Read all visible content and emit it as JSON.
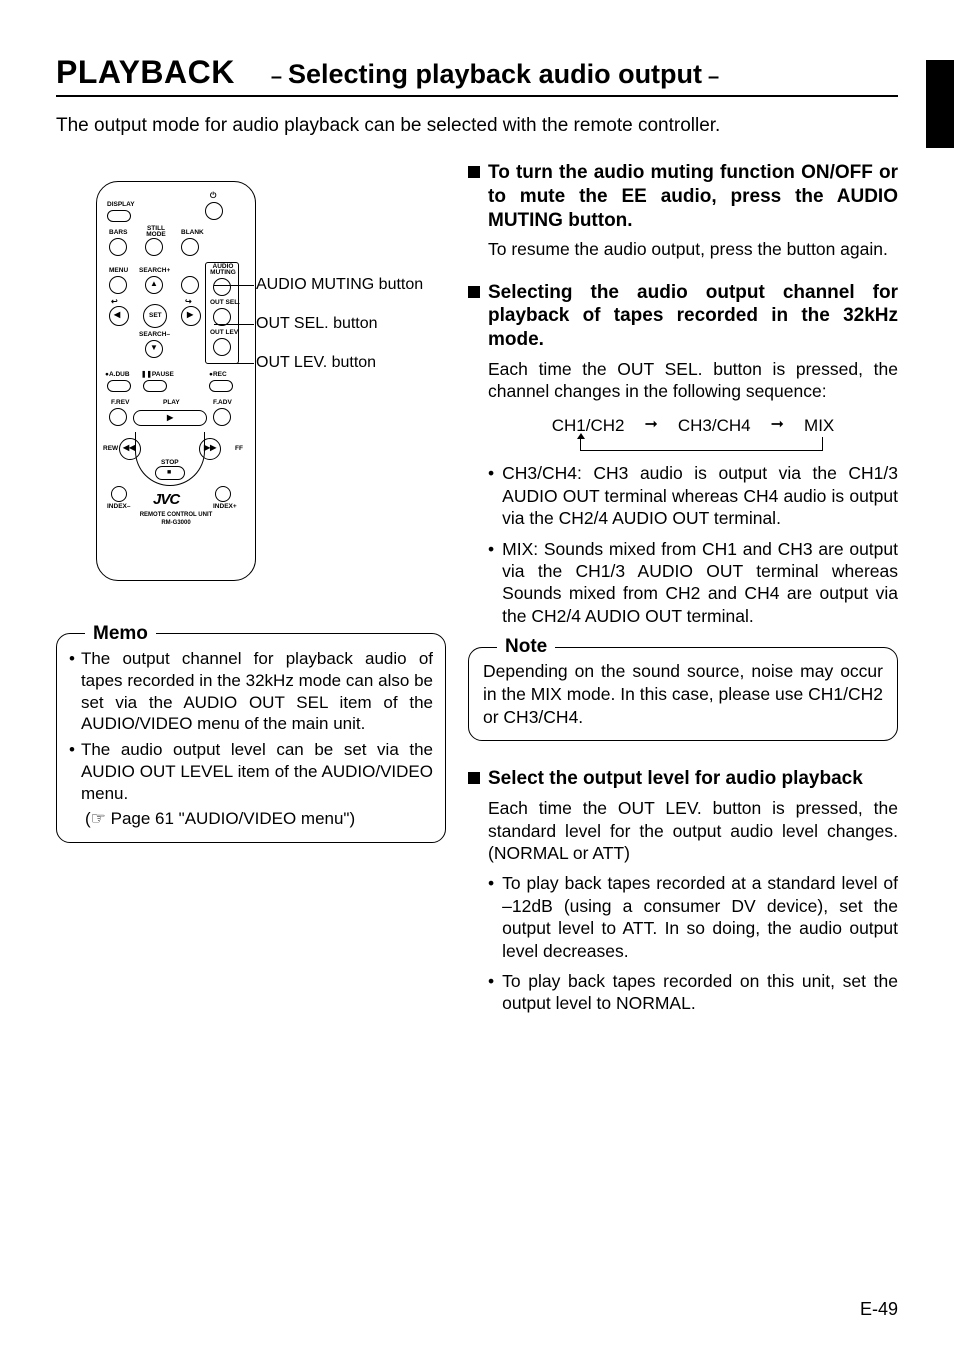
{
  "header": {
    "section": "PLAYBACK",
    "subtitle": "Selecting playback audio output"
  },
  "intro": "The output mode for audio playback can be selected with the remote controller.",
  "remote": {
    "labels": {
      "display": "DISPLAY",
      "bars": "BARS",
      "still_mode": "STILL MODE",
      "blank": "BLANK",
      "menu": "MENU",
      "search_plus": "SEARCH+",
      "audio_muting": "AUDIO MUTING",
      "set": "SET",
      "out_sel": "OUT SEL.",
      "search_minus": "SEARCH–",
      "out_lev": "OUT LEV.",
      "adub": "A.DUB",
      "pause": "PAUSE",
      "rec": "REC",
      "frev": "F.REV",
      "play": "PLAY",
      "fadv": "F.ADV",
      "rew": "REW",
      "ff": "FF",
      "stop": "STOP",
      "index_minus": "INDEX–",
      "index_plus": "INDEX+",
      "brand": "JVC",
      "model_line1": "REMOTE CONTROL UNIT",
      "model_line2": "RM-G3000"
    },
    "callouts": [
      "AUDIO MUTING button",
      "OUT SEL. button",
      "OUT LEV. button"
    ]
  },
  "memo": {
    "title": "Memo",
    "items": [
      "The output channel for playback audio of tapes recorded in the 32kHz mode can also be set via the AUDIO OUT SEL item of the AUDIO/VIDEO menu of the main unit.",
      "The audio output level can be set via the AUDIO OUT LEVEL item of the AUDIO/VIDEO menu."
    ],
    "reference": "(☞ Page 61 \"AUDIO/VIDEO menu\")"
  },
  "right": {
    "muting": {
      "title": "To turn the audio muting function ON/OFF or to mute the EE audio, press the AUDIO MUTING button.",
      "body": "To resume the audio output, press the button again."
    },
    "outsel": {
      "title": "Selecting the audio output channel for playback of tapes recorded in the 32kHz mode.",
      "body": "Each time the OUT SEL. button is pressed, the channel changes in the following sequence:",
      "sequence": [
        "CH1/CH2",
        "CH3/CH4",
        "MIX"
      ],
      "bullets": [
        "CH3/CH4: CH3 audio is output via the CH1/3 AUDIO OUT terminal whereas CH4 audio is output via the CH2/4 AUDIO OUT terminal.",
        "MIX: Sounds mixed from CH1 and CH3 are output via the CH1/3 AUDIO OUT terminal whereas Sounds mixed from CH2 and CH4 are output via the CH2/4 AUDIO OUT terminal."
      ]
    },
    "note": {
      "title": "Note",
      "body": "Depending on the sound source, noise may occur in the MIX mode. In this case, please use CH1/CH2 or CH3/CH4."
    },
    "outlev": {
      "title": "Select the output level for audio playback",
      "body": "Each time the OUT LEV. button is pressed, the standard level for the output audio level changes. (NORMAL or ATT)",
      "bullets": [
        "To play back tapes recorded at a standard level of –12dB (using a consumer DV device), set the output level to ATT. In so doing, the audio output level decreases.",
        "To play back tapes recorded on this unit, set the output level to NORMAL."
      ]
    }
  },
  "page": "E-49"
}
